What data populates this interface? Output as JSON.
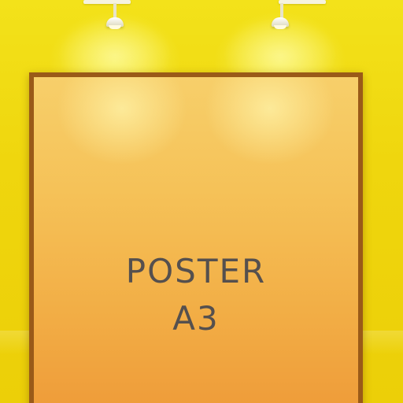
{
  "poster": {
    "line_1": "POSTER",
    "line_2": "A3"
  },
  "colors": {
    "wall": "#f0dc10",
    "frame": "#9a5a18",
    "poster_top": "#f7cf6a",
    "poster_bottom": "#ee9a38",
    "text": "#55504e"
  },
  "icons": [
    "spotlight-lamp-icon",
    "spotlight-lamp-icon"
  ]
}
